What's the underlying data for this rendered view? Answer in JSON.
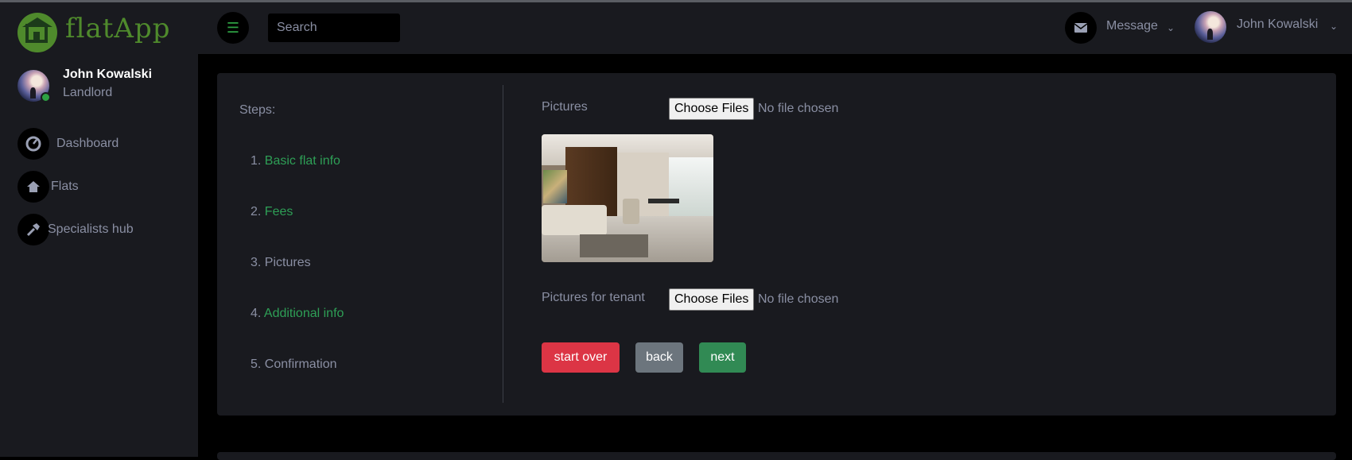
{
  "app": {
    "logo_text": "flatApp"
  },
  "sidebar": {
    "user": {
      "name": "John Kowalski",
      "role": "Landlord"
    },
    "items": [
      {
        "label": "Dashboard",
        "icon": "dashboard-icon"
      },
      {
        "label": "Flats",
        "icon": "home-icon"
      },
      {
        "label": "Specialists hub",
        "icon": "hammer-icon"
      }
    ]
  },
  "topbar": {
    "search_placeholder": "Search",
    "message_label": "Message",
    "user_name": "John Kowalski"
  },
  "steps": {
    "title": "Steps:",
    "items": [
      {
        "num": "1.",
        "label": "Basic flat info",
        "done": true
      },
      {
        "num": "2.",
        "label": "Fees",
        "done": true
      },
      {
        "num": "3.",
        "label": "Pictures",
        "done": false
      },
      {
        "num": "4.",
        "label": "Additional info",
        "done": true
      },
      {
        "num": "5.",
        "label": "Confirmation",
        "done": false
      }
    ]
  },
  "form": {
    "pictures_label": "Pictures",
    "pictures_tenant_label": "Pictures for tenant",
    "choose_files": "Choose Files",
    "no_file": "No file chosen",
    "buttons": {
      "start_over": "start over",
      "back": "back",
      "next": "next"
    }
  },
  "colors": {
    "accent_green": "#2e9f56",
    "danger": "#dc3545",
    "secondary": "#6c757d",
    "success": "#318a54"
  }
}
